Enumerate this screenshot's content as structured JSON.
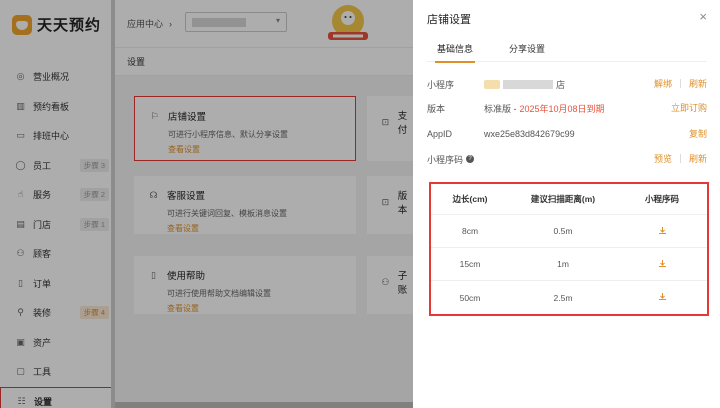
{
  "sidebar": {
    "logo_text": "天天预约",
    "items": [
      {
        "label": "营业概况",
        "icon": "◎",
        "badge": ""
      },
      {
        "label": "预约看板",
        "icon": "▥",
        "badge": ""
      },
      {
        "label": "排班中心",
        "icon": "▭",
        "badge": ""
      },
      {
        "label": "员工",
        "icon": "◯",
        "badge": "步骤 3"
      },
      {
        "label": "服务",
        "icon": "☝",
        "badge": "步骤 2"
      },
      {
        "label": "门店",
        "icon": "▤",
        "badge": "步骤 1"
      },
      {
        "label": "顾客",
        "icon": "⚇",
        "badge": ""
      },
      {
        "label": "订单",
        "icon": "▯",
        "badge": ""
      },
      {
        "label": "装修",
        "icon": "⚲",
        "badge": "步骤 4"
      },
      {
        "label": "资产",
        "icon": "▣",
        "badge": ""
      },
      {
        "label": "工具",
        "icon": "▢",
        "badge": ""
      },
      {
        "label": "设置",
        "icon": "☷",
        "badge": ""
      }
    ]
  },
  "topbar": {
    "breadcrumb_root": "应用中心",
    "breadcrumb_sep": "›",
    "select_arrow": "▾"
  },
  "main": {
    "sub_header": "设置",
    "cards": [
      {
        "title": "店铺设置",
        "desc": "可进行小程序信息、默认分享设置",
        "link": "查看设置",
        "icon": "⚐"
      },
      {
        "title": "客服设置",
        "desc": "可进行关键词回复、模板消息设置",
        "link": "查看设置",
        "icon": "☊"
      },
      {
        "title": "使用帮助",
        "desc": "可进行使用帮助文档编辑设置",
        "link": "查看设置",
        "icon": "▯"
      },
      {
        "title": "支付",
        "desc": "",
        "link": "",
        "icon": "⊡"
      },
      {
        "title": "版本",
        "desc": "",
        "link": "",
        "icon": "⊡"
      },
      {
        "title": "子账",
        "desc": "",
        "link": "",
        "icon": "⚇"
      }
    ]
  },
  "drawer": {
    "title": "店铺设置",
    "close": "×",
    "tabs": [
      {
        "label": "基础信息",
        "active": true
      },
      {
        "label": "分享设置",
        "active": false
      }
    ],
    "mini_program": {
      "label": "小程序",
      "name_suffix": "店",
      "action1": "解绑",
      "action2": "刷新"
    },
    "version": {
      "label": "版本",
      "value": "标准版 - ",
      "expire": "2025年10月08日到期",
      "action": "立即订购"
    },
    "appid": {
      "label": "AppID",
      "value": "wxe25e83d842679c99",
      "action": "复制"
    },
    "qrcode": {
      "label": "小程序码",
      "help": "?",
      "action1": "预览",
      "action2": "刷新"
    },
    "table": {
      "headers": [
        "边长(cm)",
        "建议扫描距离(m)",
        "小程序码"
      ],
      "rows": [
        [
          "8cm",
          "0.5m"
        ],
        [
          "15cm",
          "1m"
        ],
        [
          "50cm",
          "2.5m"
        ]
      ]
    }
  },
  "colors": {
    "accent": "#e0902a",
    "highlight": "#e53935",
    "expire": "#e8523a"
  }
}
